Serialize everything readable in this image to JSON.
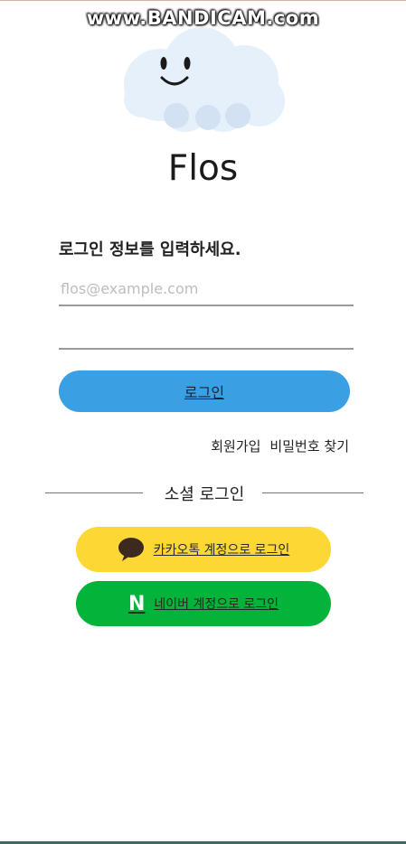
{
  "watermark": "www.BANDICAM.com",
  "app": {
    "title": "Flos"
  },
  "login": {
    "instruction": "로그인 정보를 입력하세요.",
    "email_placeholder": "flos@example.com",
    "password_value": "",
    "login_button": "로그인",
    "signup_link": "회원가입",
    "find_password_link": "비밀번호 찾기"
  },
  "social": {
    "divider_label": "소셜 로그인",
    "kakao_button": "카카오톡 계정으로 로그인",
    "naver_button": "네이버 계정으로 로그인",
    "naver_logo": "N"
  },
  "colors": {
    "login_button": "#3aa0e3",
    "kakao": "#fdd835",
    "naver": "#03b33a",
    "cloud": "#e6f0fa"
  },
  "icons": {
    "cloud_mascot": "cloud-mascot-icon",
    "kakao": "speech-bubble-icon",
    "naver": "naver-n-icon"
  }
}
